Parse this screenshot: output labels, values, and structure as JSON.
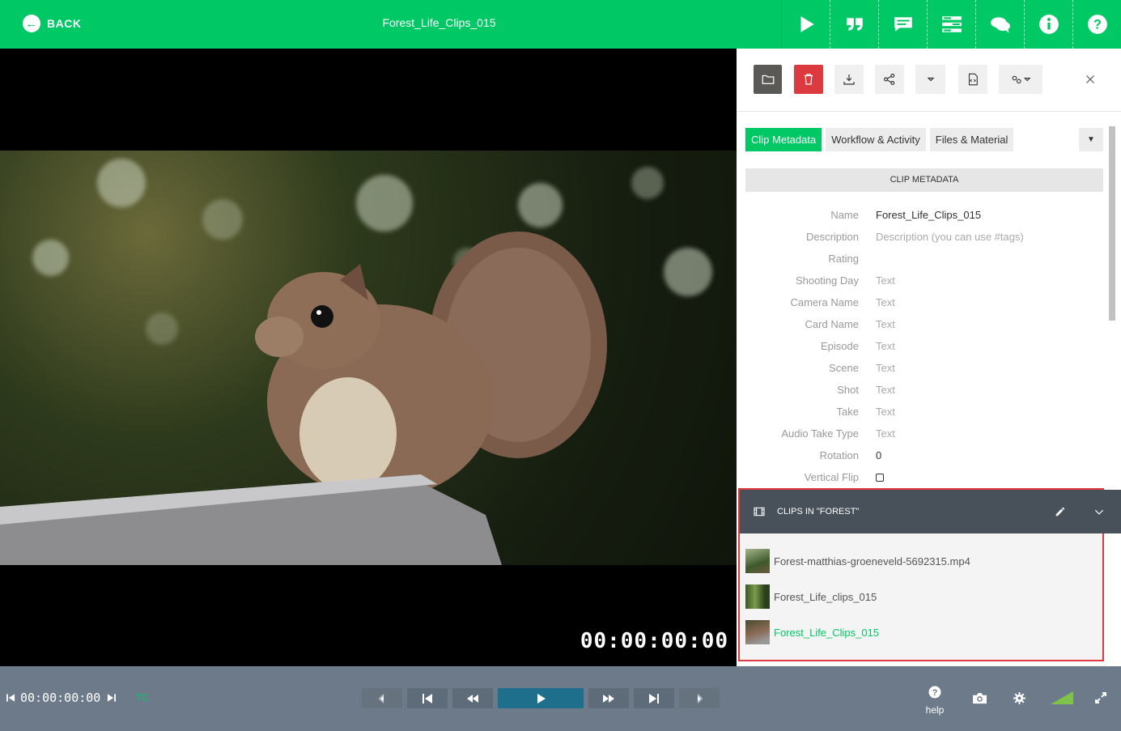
{
  "header": {
    "back_label": "BACK",
    "title": "Forest_Life_Clips_015",
    "icons": [
      "play-icon",
      "quote-icon",
      "comment-icon",
      "list-icon",
      "chat-icon",
      "info-icon",
      "help-icon"
    ]
  },
  "player": {
    "timecode": "00:00:00:00"
  },
  "panel": {
    "toolbar_icons": [
      "folder-icon",
      "trash-icon",
      "download-icon",
      "share-icon",
      "dropdown-icon",
      "file-code-icon",
      "settings-dropdown-icon",
      "close-icon"
    ],
    "tabs": [
      {
        "label": "Clip Metadata",
        "active": true
      },
      {
        "label": "Workflow & Activity",
        "active": false
      },
      {
        "label": "Files & Material",
        "active": false
      }
    ],
    "section_title": "CLIP METADATA",
    "fields": [
      {
        "label": "Name",
        "value": "Forest_Life_Clips_015",
        "placeholder": false
      },
      {
        "label": "Description",
        "value": "Description (you can use #tags)",
        "placeholder": true
      },
      {
        "label": "Rating",
        "value": "",
        "placeholder": false
      },
      {
        "label": "Shooting Day",
        "value": "Text",
        "placeholder": true
      },
      {
        "label": "Camera Name",
        "value": "Text",
        "placeholder": true
      },
      {
        "label": "Card Name",
        "value": "Text",
        "placeholder": true
      },
      {
        "label": "Episode",
        "value": "Text",
        "placeholder": true
      },
      {
        "label": "Scene",
        "value": "Text",
        "placeholder": true
      },
      {
        "label": "Shot",
        "value": "Text",
        "placeholder": true
      },
      {
        "label": "Take",
        "value": "Text",
        "placeholder": true
      },
      {
        "label": "Audio Take Type",
        "value": "Text",
        "placeholder": true
      },
      {
        "label": "Rotation",
        "value": "0",
        "placeholder": false
      },
      {
        "label": "Vertical Flip",
        "value": "",
        "placeholder": false
      }
    ]
  },
  "clips_panel": {
    "title": "CLIPS IN \"FOREST\"",
    "items": [
      {
        "name": "Forest-matthias-groeneveld-5692315.mp4",
        "active": false
      },
      {
        "name": "Forest_Life_clips_015",
        "active": false
      },
      {
        "name": "Forest_Life_Clips_015",
        "active": true
      }
    ]
  },
  "controls": {
    "timecode": "00:00:00:00",
    "tc_label": "TC",
    "help_label": "help"
  },
  "colors": {
    "brand": "#00c864",
    "bottom_bar": "#6c7a89",
    "highlight_border": "#e0393e",
    "delete_button": "#dc3a3e"
  }
}
